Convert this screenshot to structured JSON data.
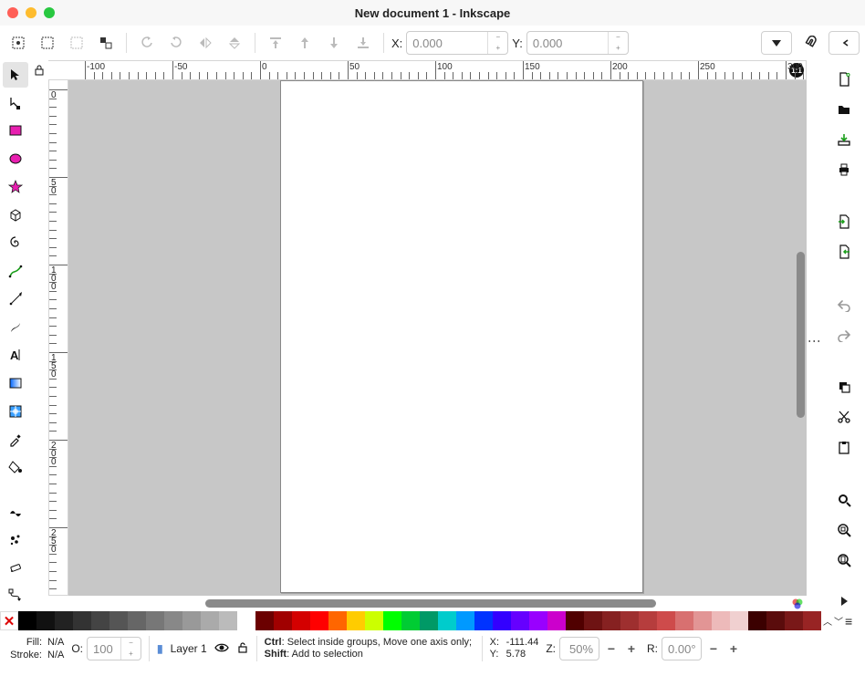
{
  "window": {
    "title": "New document 1 - Inkscape"
  },
  "toolbar": {
    "x_label": "X:",
    "y_label": "Y:",
    "x_value": "0.000",
    "y_value": "0.000"
  },
  "rulers": {
    "h": [
      "-100",
      "-50",
      "0",
      "50",
      "100",
      "150",
      "200",
      "250",
      "300"
    ],
    "v": [
      "0",
      "50",
      "100",
      "150",
      "200",
      "250"
    ],
    "reset_label": "1:1"
  },
  "statusbar": {
    "fill_label": "Fill:",
    "stroke_label": "Stroke:",
    "fill_value": "N/A",
    "stroke_value": "N/A",
    "opacity_label": "O:",
    "opacity_value": "100",
    "layer_name": "Layer 1",
    "hint_html": "<b>Ctrl</b>: Select inside groups, Move one axis only; <b>Shift</b>: Add to selection",
    "cursor_x_label": "X:",
    "cursor_y_label": "Y:",
    "cursor_x": "-111.44",
    "cursor_y": "5.78",
    "zoom_label": "Z:",
    "zoom_value": "50%",
    "rotate_label": "R:",
    "rotate_value": "0.00°"
  },
  "palette": {
    "none_label": "✕",
    "grays": [
      "#000000",
      "#111111",
      "#222222",
      "#333333",
      "#444444",
      "#555555",
      "#666666",
      "#777777",
      "#888888",
      "#999999",
      "#aaaaaa",
      "#bbbbbb"
    ],
    "colors": [
      "#6b0000",
      "#a00000",
      "#d40000",
      "#ff0000",
      "#ff6600",
      "#ffcc00",
      "#ccff00",
      "#00ff00",
      "#00cc33",
      "#009966",
      "#00cccc",
      "#0099ff",
      "#0033ff",
      "#3300ff",
      "#6600ff",
      "#9900ff",
      "#cc00cc",
      "#500000",
      "#6e1313",
      "#862121",
      "#9e2f2f",
      "#b63d3d",
      "#ce4b4b",
      "#d87070",
      "#e29595",
      "#edbaba",
      "#f0d0d0",
      "#3b0000",
      "#5a0c0c",
      "#791818",
      "#982424",
      "#b73030",
      "#c25656",
      "#cd7b7b",
      "#d9a1a1",
      "#e4c6c6",
      "#3b1010",
      "#000000"
    ]
  },
  "icons": {
    "select": "select",
    "node": "node",
    "rect": "rect",
    "ellipse": "ellipse",
    "star": "star",
    "box3d": "box3d",
    "spiral": "spiral",
    "pencil": "pencil",
    "bezier": "bezier",
    "calligraphy": "calligraphy",
    "text": "text",
    "gradient": "gradient",
    "mesh": "mesh",
    "dropper": "dropper",
    "bucket": "bucket",
    "tweak": "tweak",
    "spray": "spray",
    "eraser": "eraser",
    "connector": "connector",
    "new": "new",
    "open": "open",
    "save": "save",
    "print": "print",
    "import": "import",
    "export": "export",
    "undo": "undo",
    "redo": "redo",
    "copy": "copy",
    "cut": "cut",
    "paste": "paste",
    "zoomsel": "zoomsel",
    "zoomdraw": "zoomdraw",
    "zoompage": "zoompage"
  }
}
